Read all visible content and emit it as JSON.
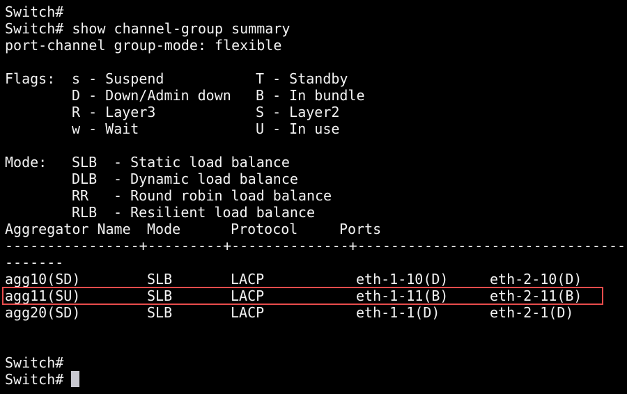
{
  "terminal": {
    "prompt_line_1": "Switch#",
    "command_line": "Switch# show channel-group summary",
    "group_mode_line": "port-channel group-mode: flexible",
    "flags_label": "Flags:",
    "flags": [
      {
        "left": "s - Suspend",
        "right": "T - Standby"
      },
      {
        "left": "D - Down/Admin down",
        "right": "B - In bundle"
      },
      {
        "left": "R - Layer3",
        "right": "S - Layer2"
      },
      {
        "left": "w - Wait",
        "right": "U - In use"
      }
    ],
    "mode_label": "Mode:",
    "modes": [
      {
        "code": "SLB",
        "desc": "- Static load balance"
      },
      {
        "code": "DLB",
        "desc": "- Dynamic load balance"
      },
      {
        "code": "RR",
        "desc": "- Round robin load balance"
      },
      {
        "code": "RLB",
        "desc": "- Resilient load balance"
      }
    ],
    "table": {
      "headers": {
        "name": "Aggregator Name",
        "mode": "Mode",
        "protocol": "Protocol",
        "ports": "Ports"
      },
      "separator_line_1": "----------------+---------+--------------+------------------------------------------",
      "separator_line_2": "-------",
      "rows": [
        {
          "name": "agg10(SD)",
          "mode": "SLB",
          "protocol": "LACP",
          "port1": "eth-1-10(D)",
          "port2": "eth-2-10(D)"
        },
        {
          "name": "agg11(SU)",
          "mode": "SLB",
          "protocol": "LACP",
          "port1": "eth-1-11(B)",
          "port2": "eth-2-11(B)"
        },
        {
          "name": "agg20(SD)",
          "mode": "SLB",
          "protocol": "LACP",
          "port1": "eth-1-1(D)",
          "port2": "eth-2-1(D)"
        }
      ]
    },
    "final_prompt_1": "Switch#",
    "final_prompt_2": "Switch#",
    "highlighted_row": "agg11(SU)",
    "highlight_color": "#e84c4c",
    "background_color": "#000000",
    "text_color": "#f2f2f2"
  }
}
